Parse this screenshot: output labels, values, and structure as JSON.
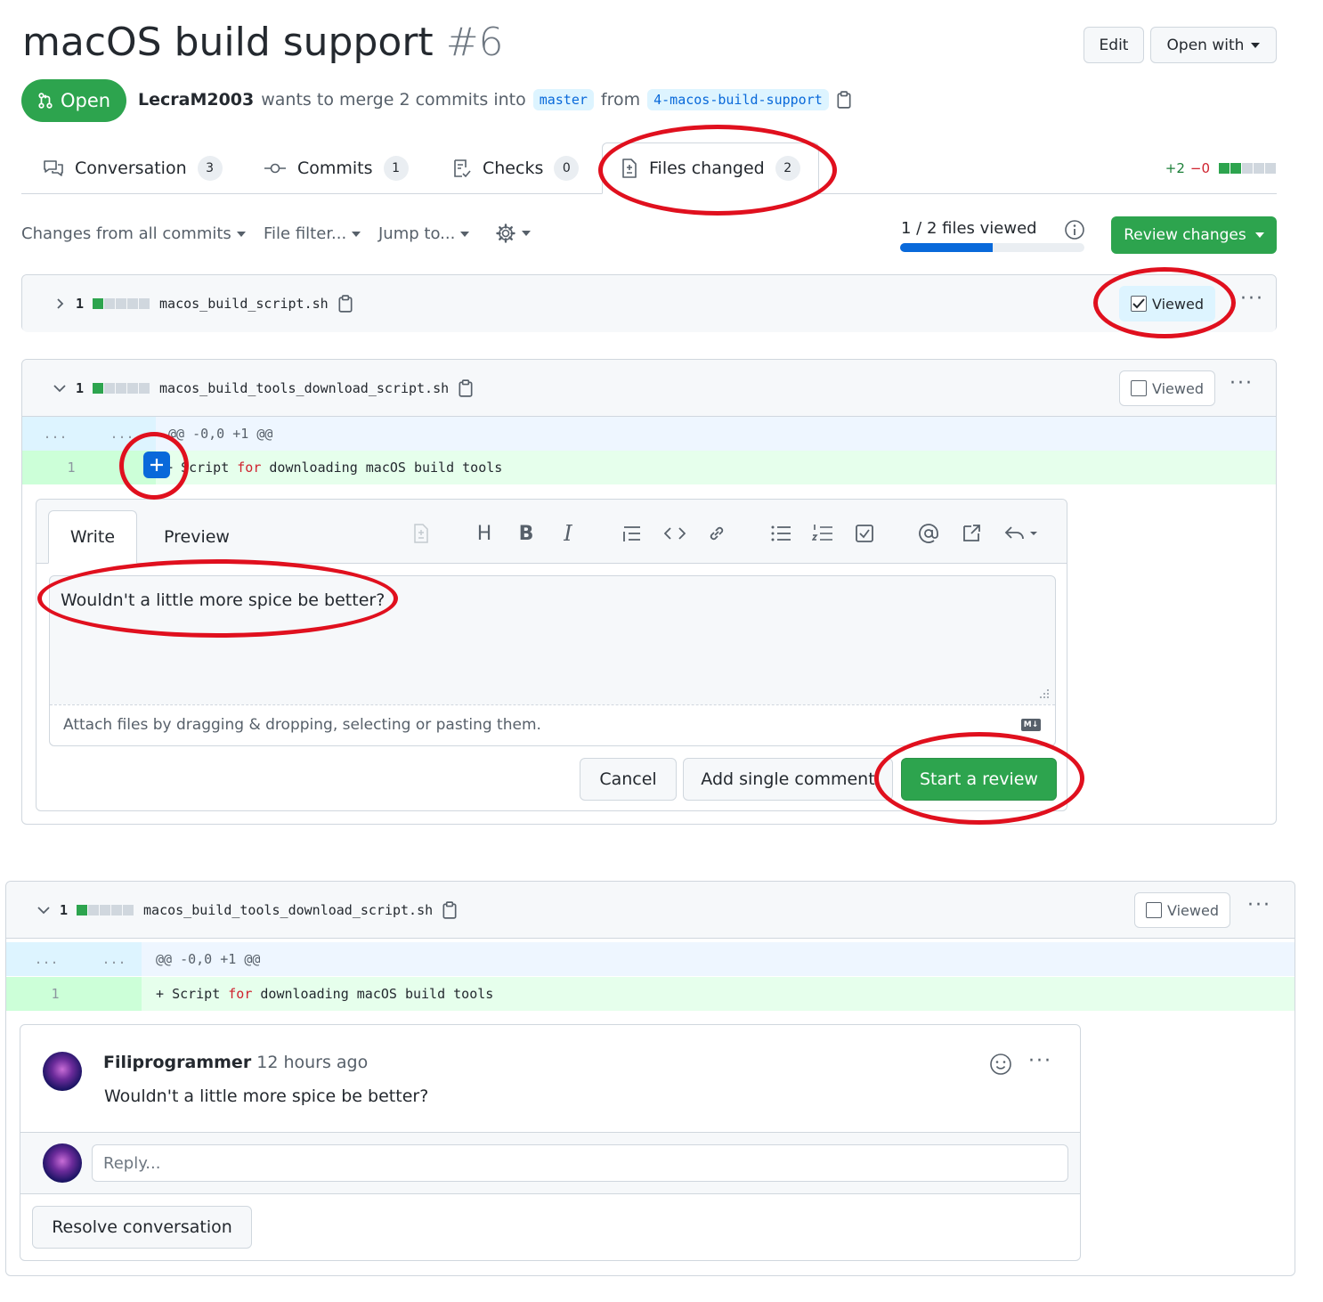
{
  "pr": {
    "title": "macOS build support",
    "number": "#6",
    "state": "Open",
    "author": "LecraM2003",
    "merge_text": "wants to merge 2 commits into",
    "base_branch": "master",
    "from_text": "from",
    "head_branch": "4-macos-build-support",
    "edit_label": "Edit",
    "open_with_label": "Open with"
  },
  "tabs": [
    {
      "label": "Conversation",
      "count": "3",
      "icon": "comment-discussion-icon"
    },
    {
      "label": "Commits",
      "count": "1",
      "icon": "commit-icon"
    },
    {
      "label": "Checks",
      "count": "0",
      "icon": "checklist-icon"
    },
    {
      "label": "Files changed",
      "count": "2",
      "icon": "file-diff-icon"
    }
  ],
  "diffstat": {
    "additions": "+2",
    "deletions": "−0"
  },
  "toolbar": {
    "changes_from": "Changes from all commits",
    "file_filter": "File filter...",
    "jump_to": "Jump to...",
    "files_viewed": "1 / 2 files viewed",
    "files_viewed_fraction": 0.5,
    "review_changes": "Review changes"
  },
  "files": [
    {
      "count": "1",
      "name": "macos_build_script.sh",
      "viewed_label": "Viewed",
      "viewed": true
    },
    {
      "count": "1",
      "name": "macos_build_tools_download_script.sh",
      "viewed_label": "Viewed",
      "viewed": false
    },
    {
      "count": "1",
      "name": "macos_build_tools_download_script.sh",
      "viewed_label": "Viewed",
      "viewed": false
    }
  ],
  "diff": {
    "hunk_gutter": "...",
    "hunk_header": "@@ -0,0 +1 @@",
    "line_number": "1",
    "line_prefix": "+ ",
    "line_text_before": "Script ",
    "line_keyword": "for",
    "line_text_after": " downloading macOS build tools"
  },
  "comment_form": {
    "write_tab": "Write",
    "preview_tab": "Preview",
    "text": "Wouldn't a little more spice be better?",
    "attach_hint": "Attach files by dragging & dropping, selecting or pasting them.",
    "markdown_badge": "M↓",
    "cancel": "Cancel",
    "add_single": "Add single comment",
    "start_review": "Start a review"
  },
  "thread": {
    "author": "Filiprogrammer",
    "time": "12 hours ago",
    "body": "Wouldn't a little more spice be better?",
    "reply_placeholder": "Reply...",
    "resolve": "Resolve conversation"
  },
  "colors": {
    "accent_green": "#2da44e",
    "link_blue": "#0969da",
    "annotation_red": "#e0101e"
  }
}
